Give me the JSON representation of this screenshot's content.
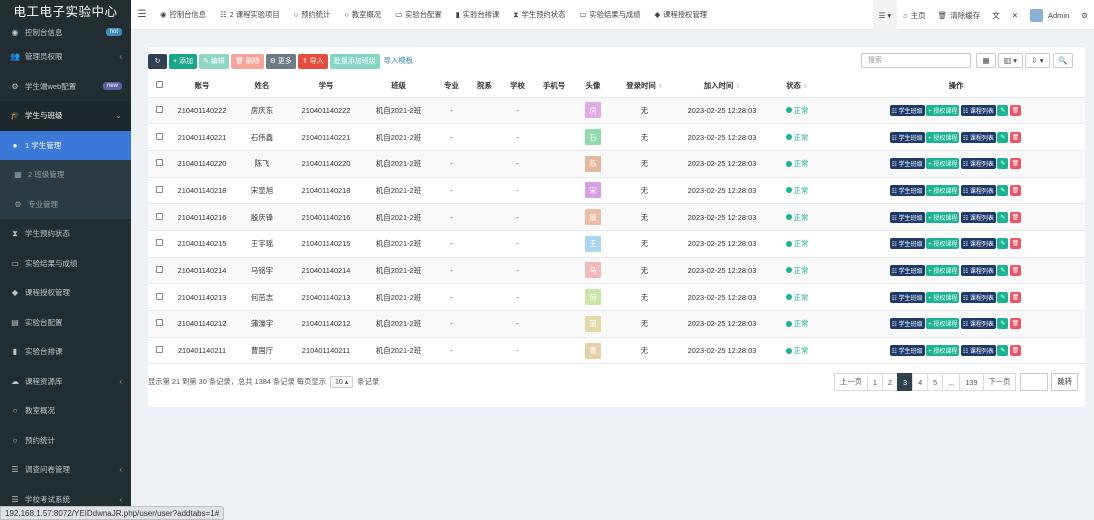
{
  "app_title": "电工电子实验中心",
  "sidebar": {
    "items": [
      {
        "label": "控制台信息",
        "icon": "dashboard-icon",
        "glyph": "◉",
        "badge": "hot",
        "badge_type": "hot",
        "arrow": "",
        "state": "first"
      },
      {
        "label": "管理员权限",
        "icon": "users-icon",
        "glyph": "👥",
        "badge": "",
        "badge_type": "",
        "arrow": "‹",
        "state": ""
      },
      {
        "label": "学生端web配置",
        "icon": "cogs-icon",
        "glyph": "⚙",
        "badge": "new",
        "badge_type": "new",
        "arrow": "",
        "state": ""
      },
      {
        "label": "学生与班级",
        "icon": "graduation-cap-icon",
        "glyph": "🎓",
        "badge": "",
        "badge_type": "",
        "arrow": "⌄",
        "state": "open"
      },
      {
        "label": "1 学生管理",
        "icon": "user-circle-icon",
        "glyph": "●",
        "badge": "",
        "badge_type": "",
        "arrow": "",
        "state": "active"
      },
      {
        "label": "2 班级管理",
        "icon": "grid-icon",
        "glyph": "▦",
        "badge": "",
        "badge_type": "",
        "arrow": "",
        "state": "sub"
      },
      {
        "label": "专业管理",
        "icon": "gear-icon",
        "glyph": "⚙",
        "badge": "",
        "badge_type": "",
        "arrow": "",
        "state": "sub"
      },
      {
        "label": "学生预约状态",
        "icon": "hourglass-icon",
        "glyph": "⧗",
        "badge": "",
        "badge_type": "",
        "arrow": "",
        "state": ""
      },
      {
        "label": "实验结果与成绩",
        "icon": "monitor-icon",
        "glyph": "▭",
        "badge": "",
        "badge_type": "",
        "arrow": "",
        "state": ""
      },
      {
        "label": "课程授权管理",
        "icon": "tag-icon",
        "glyph": "◆",
        "badge": "",
        "badge_type": "",
        "arrow": "",
        "state": ""
      },
      {
        "label": "实验台配置",
        "icon": "keyboard-icon",
        "glyph": "▤",
        "badge": "",
        "badge_type": "",
        "arrow": "",
        "state": ""
      },
      {
        "label": "实验台排课",
        "icon": "mobile-icon",
        "glyph": "▮",
        "badge": "",
        "badge_type": "",
        "arrow": "",
        "state": ""
      },
      {
        "label": "课程资源库",
        "icon": "cloud-icon",
        "glyph": "☁",
        "badge": "",
        "badge_type": "",
        "arrow": "‹",
        "state": ""
      },
      {
        "label": "教室概况",
        "icon": "circle-icon",
        "glyph": "○",
        "badge": "",
        "badge_type": "",
        "arrow": "",
        "state": ""
      },
      {
        "label": "预约统计",
        "icon": "circle-icon",
        "glyph": "○",
        "badge": "",
        "badge_type": "",
        "arrow": "",
        "state": ""
      },
      {
        "label": "调查问卷管理",
        "icon": "list-icon",
        "glyph": "☰",
        "badge": "",
        "badge_type": "",
        "arrow": "‹",
        "state": ""
      },
      {
        "label": "学校考试系统",
        "icon": "list-icon",
        "glyph": "☰",
        "badge": "",
        "badge_type": "",
        "arrow": "‹",
        "state": ""
      }
    ]
  },
  "topbar": {
    "tabs": [
      {
        "label": "控制台信息",
        "icon": "dashboard-icon",
        "glyph": "◉"
      },
      {
        "label": "2 课程实验项目",
        "icon": "list-icon",
        "glyph": "☷"
      },
      {
        "label": "预约统计",
        "icon": "circle-icon",
        "glyph": "○"
      },
      {
        "label": "教室概况",
        "icon": "circle-icon",
        "glyph": "○"
      },
      {
        "label": "实验台配置",
        "icon": "keyboard-icon",
        "glyph": "▭"
      },
      {
        "label": "实验台排课",
        "icon": "mobile-icon",
        "glyph": "▮"
      },
      {
        "label": "学生预约状态",
        "icon": "hourglass-icon",
        "glyph": "⧗"
      },
      {
        "label": "实验结果与成绩",
        "icon": "monitor-icon",
        "glyph": "▭"
      },
      {
        "label": "课程授权管理",
        "icon": "tag-icon",
        "glyph": "◆"
      }
    ],
    "right": {
      "menu_glyph": "☰ ▾",
      "home_label": "主页",
      "clear_cache_label": "清除缓存",
      "translate_glyph": "文",
      "fullscreen_glyph": "✕",
      "user_name": "Admin",
      "settings_glyph": "⚙"
    }
  },
  "toolbar": {
    "refresh_glyph": "↻",
    "add_label": "+ 添加",
    "edit_label": "✎ 编辑",
    "delete_label": "🗑 删除",
    "more_label": "⚙ 更多",
    "import_label": "⇪ 导入",
    "batch_class_label": "批量添加班级",
    "import_template_label": "导入模板",
    "search_placeholder": "搜索",
    "view_glyph": "▦",
    "columns_glyph": "▥ ▾",
    "export_glyph": "⇩ ▾",
    "search_glyph": "🔍"
  },
  "table": {
    "columns": [
      "",
      "账号",
      "姓名",
      "学号",
      "班级",
      "专业",
      "院系",
      "学校",
      "手机号",
      "头像",
      "登录时间",
      "加入时间",
      "状态",
      "操作"
    ],
    "rows": [
      {
        "account": "210401140222",
        "name": "房庆东",
        "student_no": "210401140222",
        "class": "机自2021-2班",
        "major": "-",
        "dept": "",
        "school": "-",
        "phone": "",
        "avatar_char": "房",
        "avatar_color": "#d98fe0",
        "login": "无",
        "joined": "2023-02-25 12:28:03",
        "status": "正常"
      },
      {
        "account": "210401140221",
        "name": "石伟鑫",
        "student_no": "210401140221",
        "class": "机自2021-2班",
        "major": "-",
        "dept": "",
        "school": "-",
        "phone": "",
        "avatar_char": "石",
        "avatar_color": "#6ccf8f",
        "login": "无",
        "joined": "2023-02-25 12:28:03",
        "status": "正常"
      },
      {
        "account": "210401140220",
        "name": "陈飞",
        "student_no": "210401140220",
        "class": "机自2021-2班",
        "major": "-",
        "dept": "",
        "school": "-",
        "phone": "",
        "avatar_char": "陈",
        "avatar_color": "#e0a37c",
        "login": "无",
        "joined": "2023-02-25 12:28:03",
        "status": "正常"
      },
      {
        "account": "210401140218",
        "name": "宋显旭",
        "student_no": "210401140218",
        "class": "机自2021-2班",
        "major": "-",
        "dept": "",
        "school": "-",
        "phone": "",
        "avatar_char": "宋",
        "avatar_color": "#c87fe0",
        "login": "无",
        "joined": "2023-02-25 12:28:03",
        "status": "正常"
      },
      {
        "account": "210401140216",
        "name": "殷庆锋",
        "student_no": "210401140216",
        "class": "机自2021-2班",
        "major": "-",
        "dept": "",
        "school": "-",
        "phone": "",
        "avatar_char": "殷",
        "avatar_color": "#e8a88a",
        "login": "无",
        "joined": "2023-02-25 12:28:03",
        "status": "正常"
      },
      {
        "account": "210401140215",
        "name": "王宇瑶",
        "student_no": "210401140215",
        "class": "机自2021-2班",
        "major": "-",
        "dept": "",
        "school": "-",
        "phone": "",
        "avatar_char": "王",
        "avatar_color": "#8ec9ef",
        "login": "无",
        "joined": "2023-02-25 12:28:03",
        "status": "正常"
      },
      {
        "account": "210401140214",
        "name": "马铭宇",
        "student_no": "210401140214",
        "class": "机自2021-2班",
        "major": "-",
        "dept": "",
        "school": "-",
        "phone": "",
        "avatar_char": "马",
        "avatar_color": "#f0a4a4",
        "login": "无",
        "joined": "2023-02-25 12:28:03",
        "status": "正常"
      },
      {
        "account": "210401140213",
        "name": "何茁志",
        "student_no": "210401140213",
        "class": "机自2021-2班",
        "major": "-",
        "dept": "",
        "school": "-",
        "phone": "",
        "avatar_char": "何",
        "avatar_color": "#b9e08a",
        "login": "无",
        "joined": "2023-02-25 12:28:03",
        "status": "正常"
      },
      {
        "account": "210401140212",
        "name": "蒲濠宇",
        "student_no": "210401140212",
        "class": "机自2021-2班",
        "major": "-",
        "dept": "",
        "school": "-",
        "phone": "",
        "avatar_char": "蒲",
        "avatar_color": "#dccf8c",
        "login": "无",
        "joined": "2023-02-25 12:28:03",
        "status": "正常"
      },
      {
        "account": "210401140211",
        "name": "曹国厅",
        "student_no": "210401140211",
        "class": "机自2021-2班",
        "major": "-",
        "dept": "",
        "school": "-",
        "phone": "",
        "avatar_char": "曹",
        "avatar_color": "#e0c08a",
        "login": "无",
        "joined": "2023-02-25 12:28:03",
        "status": "正常"
      }
    ],
    "row_actions": {
      "class_label": "☷ 学生班级",
      "grant_label": "+ 授权课程",
      "courses_label": "☷ 课程列表",
      "edit_glyph": "✎",
      "delete_glyph": "🗑"
    }
  },
  "footer": {
    "info_prefix": "显示第 21 到第 30 条记录，总共 1384 条记录 每页显示",
    "page_size": "10 ▴",
    "info_suffix": "条记录",
    "pages": [
      "上一页",
      "1",
      "2",
      "3",
      "4",
      "5",
      "...",
      "139",
      "下一页"
    ],
    "current_page": "3",
    "jump_label": "跳转"
  },
  "status_url": "192.168.1.57:8072/YEIDdwnaJR.php/user/user?addtabs=1#",
  "colors": {
    "sidebar_bg": "#222d32",
    "active_blue": "#3c78d8",
    "primary_green": "#18a689",
    "status_green": "#1ab394",
    "danger": "#ed5565",
    "navy": "#1c3a6b"
  }
}
